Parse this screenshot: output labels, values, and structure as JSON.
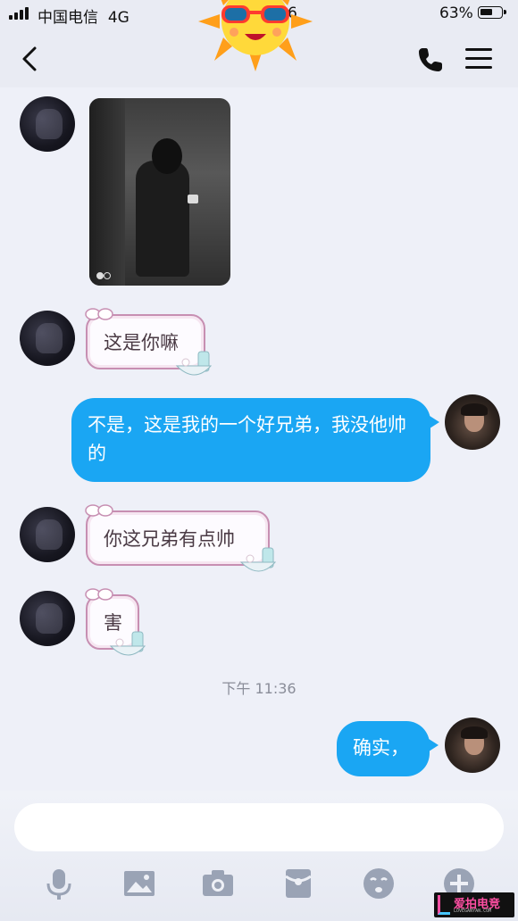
{
  "status_bar": {
    "carrier": "中国电信",
    "network": "4G",
    "time_fragment": "6",
    "battery_percent": "63%",
    "battery_level": 0.63
  },
  "nav_bar": {
    "back_icon": "chevron-left-icon",
    "call_icon": "phone-icon",
    "menu_icon": "hamburger-menu-icon",
    "sticker": "sun-with-sunglasses"
  },
  "messages": [
    {
      "direction": "incoming",
      "type": "image"
    },
    {
      "direction": "incoming",
      "type": "text",
      "text": "这是你嘛"
    },
    {
      "direction": "outgoing",
      "type": "text",
      "text": "不是，这是我的一个好兄弟，我没他帅的"
    },
    {
      "direction": "incoming",
      "type": "text",
      "text": "你这兄弟有点帅"
    },
    {
      "direction": "incoming",
      "type": "text",
      "text": "害"
    },
    {
      "direction": "outgoing",
      "type": "text",
      "text": "确实，"
    }
  ],
  "timestamp": "下午 11:36",
  "input_bar": {
    "placeholder": "",
    "tools": [
      "microphone-icon",
      "image-icon",
      "camera-icon",
      "red-packet-icon",
      "emoji-icon",
      "plus-icon"
    ]
  },
  "colors": {
    "outgoing_bubble": "#1aa6f3",
    "incoming_border": "#c78fb2",
    "background": "#eef0f8"
  },
  "watermark": {
    "text": "爱拍电竞",
    "sub": "LOVEGANYAN.COM"
  }
}
